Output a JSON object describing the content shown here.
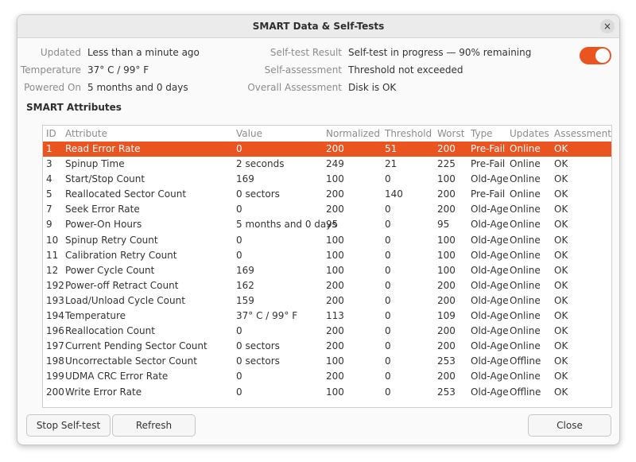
{
  "window": {
    "title": "SMART Data & Self-Tests",
    "close_glyph": "×"
  },
  "info_left": [
    {
      "label": "Updated",
      "value": "Less than a minute ago"
    },
    {
      "label": "Temperature",
      "value": "37° C / 99° F"
    },
    {
      "label": "Powered On",
      "value": "5 months and 0 days"
    }
  ],
  "info_right": [
    {
      "label": "Self-test Result",
      "value": "Self-test in progress — 90% remaining"
    },
    {
      "label": "Self-assessment",
      "value": "Threshold not exceeded"
    },
    {
      "label": "Overall Assessment",
      "value": "Disk is OK"
    }
  ],
  "smart_toggle": {
    "on": true,
    "accent": "#e95420"
  },
  "section_title": "SMART Attributes",
  "table": {
    "headers": [
      "ID",
      "Attribute",
      "Value",
      "Normalized",
      "Threshold",
      "Worst",
      "Type",
      "Updates",
      "Assessment"
    ],
    "selected_row": 0,
    "rows": [
      [
        "1",
        "Read Error Rate",
        "0",
        "200",
        "51",
        "200",
        "Pre-Fail",
        "Online",
        "OK"
      ],
      [
        "3",
        "Spinup Time",
        "2 seconds",
        "249",
        "21",
        "225",
        "Pre-Fail",
        "Online",
        "OK"
      ],
      [
        "4",
        "Start/Stop Count",
        "169",
        "100",
        "0",
        "100",
        "Old-Age",
        "Online",
        "OK"
      ],
      [
        "5",
        "Reallocated Sector Count",
        "0 sectors",
        "200",
        "140",
        "200",
        "Pre-Fail",
        "Online",
        "OK"
      ],
      [
        "7",
        "Seek Error Rate",
        "0",
        "200",
        "0",
        "200",
        "Old-Age",
        "Online",
        "OK"
      ],
      [
        "9",
        "Power-On Hours",
        "5 months and 0 days",
        "95",
        "0",
        "95",
        "Old-Age",
        "Online",
        "OK"
      ],
      [
        "10",
        "Spinup Retry Count",
        "0",
        "100",
        "0",
        "100",
        "Old-Age",
        "Online",
        "OK"
      ],
      [
        "11",
        "Calibration Retry Count",
        "0",
        "100",
        "0",
        "100",
        "Old-Age",
        "Online",
        "OK"
      ],
      [
        "12",
        "Power Cycle Count",
        "169",
        "100",
        "0",
        "100",
        "Old-Age",
        "Online",
        "OK"
      ],
      [
        "192",
        "Power-off Retract Count",
        "162",
        "200",
        "0",
        "200",
        "Old-Age",
        "Online",
        "OK"
      ],
      [
        "193",
        "Load/Unload Cycle Count",
        "159",
        "200",
        "0",
        "200",
        "Old-Age",
        "Online",
        "OK"
      ],
      [
        "194",
        "Temperature",
        "37° C / 99° F",
        "113",
        "0",
        "109",
        "Old-Age",
        "Online",
        "OK"
      ],
      [
        "196",
        "Reallocation Count",
        "0",
        "200",
        "0",
        "200",
        "Old-Age",
        "Online",
        "OK"
      ],
      [
        "197",
        "Current Pending Sector Count",
        "0 sectors",
        "200",
        "0",
        "200",
        "Old-Age",
        "Online",
        "OK"
      ],
      [
        "198",
        "Uncorrectable Sector Count",
        "0 sectors",
        "100",
        "0",
        "253",
        "Old-Age",
        "Offline",
        "OK"
      ],
      [
        "199",
        "UDMA CRC Error Rate",
        "0",
        "200",
        "0",
        "200",
        "Old-Age",
        "Online",
        "OK"
      ],
      [
        "200",
        "Write Error Rate",
        "0",
        "100",
        "0",
        "253",
        "Old-Age",
        "Offline",
        "OK"
      ]
    ]
  },
  "buttons": {
    "stop": "Stop Self-test",
    "refresh": "Refresh",
    "close": "Close"
  }
}
